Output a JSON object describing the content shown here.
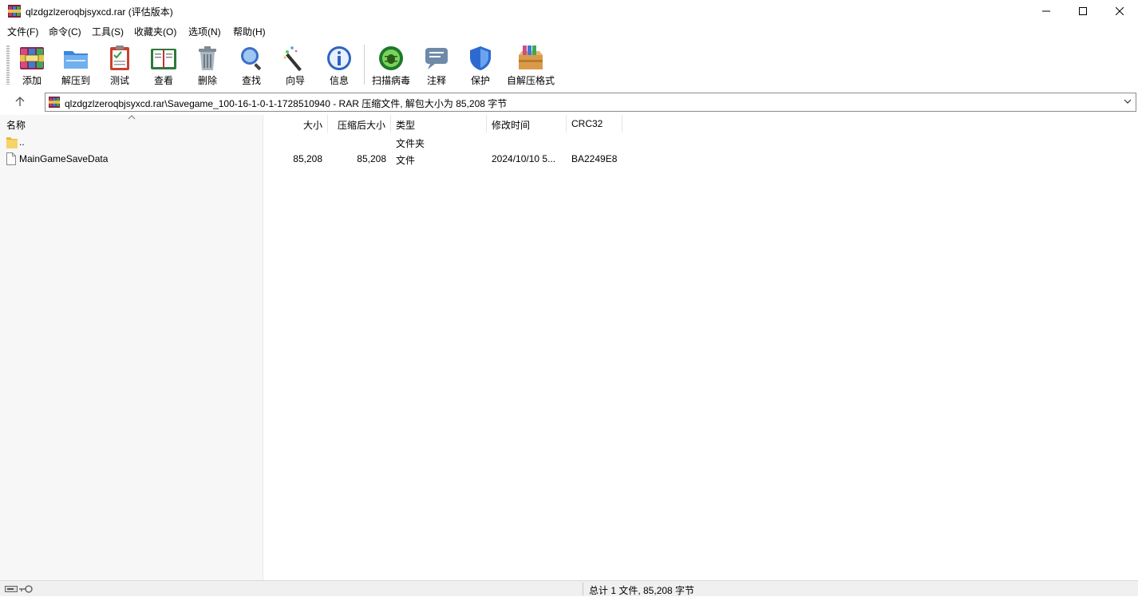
{
  "window": {
    "title": "qlzdgzlzeroqbjsyxcd.rar (评估版本)"
  },
  "menu": [
    "文件(F)",
    "命令(C)",
    "工具(S)",
    "收藏夹(O)",
    "选项(N)",
    "帮助(H)"
  ],
  "toolbar": [
    {
      "label": "添加",
      "icon": "add-archive-icon"
    },
    {
      "label": "解压到",
      "icon": "extract-folder-icon"
    },
    {
      "label": "测试",
      "icon": "test-clipboard-icon"
    },
    {
      "label": "查看",
      "icon": "view-book-icon"
    },
    {
      "label": "删除",
      "icon": "trash-icon"
    },
    {
      "label": "查找",
      "icon": "find-magnifier-icon"
    },
    {
      "label": "向导",
      "icon": "wizard-wand-icon"
    },
    {
      "label": "信息",
      "icon": "info-icon"
    },
    {
      "label": "扫描病毒",
      "icon": "virus-scan-icon"
    },
    {
      "label": "注释",
      "icon": "comment-icon"
    },
    {
      "label": "保护",
      "icon": "shield-icon"
    },
    {
      "label": "自解压格式",
      "icon": "sfx-box-icon"
    }
  ],
  "address": {
    "text": "qlzdgzlzeroqbjsyxcd.rar\\Savegame_100-16-1-0-1-1728510940 - RAR 压缩文件, 解包大小为 85,208 字节"
  },
  "columns": [
    "名称",
    "大小",
    "压缩后大小",
    "类型",
    "修改时间",
    "CRC32"
  ],
  "rows": [
    {
      "name": "..",
      "size": "",
      "packed": "",
      "type": "文件夹",
      "modified": "",
      "crc": "",
      "icon": "folder-icon"
    },
    {
      "name": "MainGameSaveData",
      "size": "85,208",
      "packed": "85,208",
      "type": "文件",
      "modified": "2024/10/10 5...",
      "crc": "BA2249E8",
      "icon": "file-icon"
    }
  ],
  "status": {
    "summary": "总计 1 文件, 85,208 字节"
  },
  "colors": {
    "accent": "#1e6fc8",
    "folder": "#f7d36b",
    "addr_border": "#8c8c8c"
  }
}
